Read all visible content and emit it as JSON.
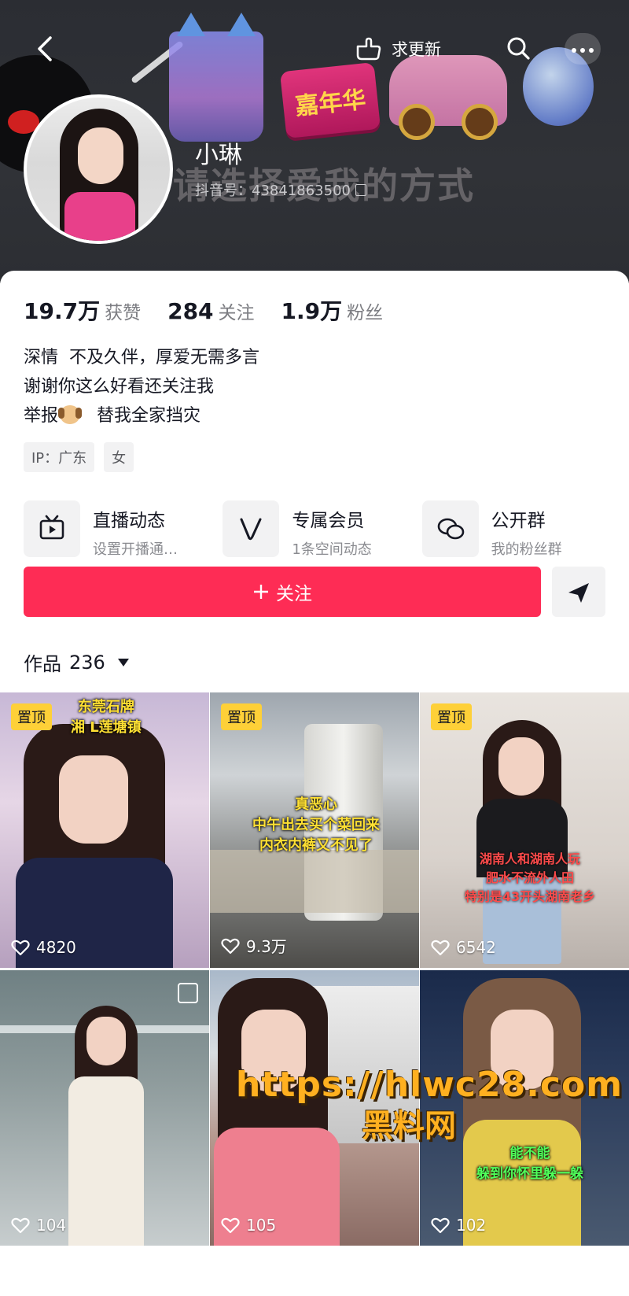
{
  "header": {
    "refresh_label": "求更新",
    "banner_slogan": "请选择爱我的方式",
    "banner_badge": "嘉年华",
    "nickname": "小琳",
    "douyin_id": "抖音号：43841863500"
  },
  "stats": [
    {
      "num": "19.7万",
      "label": "获赞"
    },
    {
      "num": "284",
      "label": "关注"
    },
    {
      "num": "1.9万",
      "label": "粉丝"
    }
  ],
  "bio": {
    "line1": "深情  不及久伴，厚爱无需多言",
    "line2": "谢谢你这么好看还关注我",
    "line3_prefix": "举报",
    "line3_suffix": "   替我全家挡灾"
  },
  "tags": [
    "IP：广东",
    "女"
  ],
  "features": [
    {
      "icon": "tv-icon",
      "title": "直播动态",
      "subtitle": "设置开播通…"
    },
    {
      "icon": "vip-v-icon",
      "title": "专属会员",
      "subtitle": "1条空间动态"
    },
    {
      "icon": "chat-group-icon",
      "title": "公开群",
      "subtitle": "我的粉丝群"
    }
  ],
  "actions": {
    "follow_label": "关注",
    "follow_color": "#fe2c55"
  },
  "works_tab": {
    "label": "作品",
    "count": "236"
  },
  "videos": [
    {
      "pinned": true,
      "pin_label": "置顶",
      "likes": "4820",
      "caption": "东莞石牌\n湘 L莲塘镇"
    },
    {
      "pinned": true,
      "pin_label": "置顶",
      "likes": "9.3万",
      "caption": "真恶心\n中午出去买个菜回来\n内衣内裤又不见了"
    },
    {
      "pinned": true,
      "pin_label": "置顶",
      "likes": "6542",
      "caption": "湖南人和湖南人玩\n肥水不流外人田\n特别是43开头湖南老乡"
    },
    {
      "pinned": false,
      "pin_label": "",
      "likes": "104",
      "caption": ""
    },
    {
      "pinned": false,
      "pin_label": "",
      "likes": "105",
      "caption": ""
    },
    {
      "pinned": false,
      "pin_label": "",
      "likes": "102",
      "caption": "能不能\n躲到你怀里躲一躲"
    }
  ],
  "watermark": {
    "url": "https://hlwc28.com",
    "name": "黑料网"
  }
}
